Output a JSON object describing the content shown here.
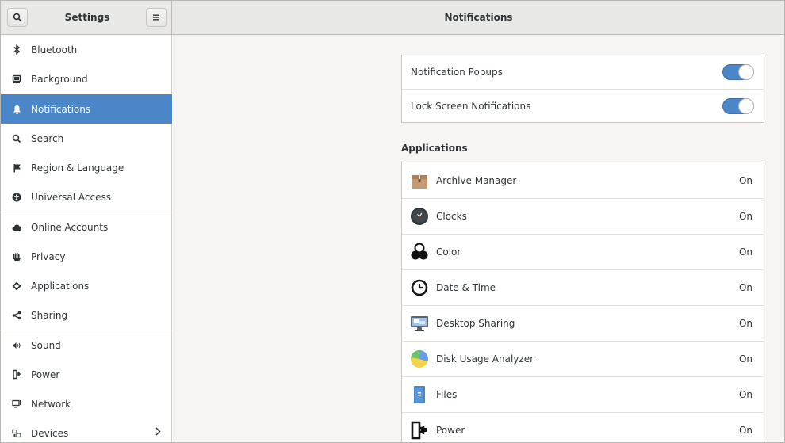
{
  "header": {
    "sidebar_title": "Settings",
    "main_title": "Notifications",
    "search_icon": "search-icon",
    "menu_icon": "hamburger-menu-icon"
  },
  "sidebar": {
    "items": [
      {
        "label": "Bluetooth",
        "icon": "bluetooth-icon"
      },
      {
        "label": "Background",
        "icon": "display-icon"
      },
      {
        "label": "Notifications",
        "icon": "bell-icon",
        "active": true
      },
      {
        "label": "Search",
        "icon": "search-icon"
      },
      {
        "label": "Region & Language",
        "icon": "flag-icon"
      },
      {
        "label": "Universal Access",
        "icon": "accessibility-icon"
      },
      {
        "label": "Online Accounts",
        "icon": "cloud-icon"
      },
      {
        "label": "Privacy",
        "icon": "hand-icon"
      },
      {
        "label": "Applications",
        "icon": "applications-icon"
      },
      {
        "label": "Sharing",
        "icon": "share-icon"
      },
      {
        "label": "Sound",
        "icon": "speaker-icon"
      },
      {
        "label": "Power",
        "icon": "power-plug-icon"
      },
      {
        "label": "Network",
        "icon": "network-icon"
      },
      {
        "label": "Devices",
        "icon": "devices-icon",
        "chevron": "chevron-right-icon"
      }
    ]
  },
  "notifications": {
    "popups_label": "Notification Popups",
    "popups_on": true,
    "lock_label": "Lock Screen Notifications",
    "lock_on": true
  },
  "applications": {
    "title": "Applications",
    "items": [
      {
        "name": "Archive Manager",
        "state": "On",
        "icon": "archive-manager-icon"
      },
      {
        "name": "Clocks",
        "state": "On",
        "icon": "clocks-icon"
      },
      {
        "name": "Color",
        "state": "On",
        "icon": "color-icon"
      },
      {
        "name": "Date & Time",
        "state": "On",
        "icon": "date-time-icon"
      },
      {
        "name": "Desktop Sharing",
        "state": "On",
        "icon": "desktop-sharing-icon"
      },
      {
        "name": "Disk Usage Analyzer",
        "state": "On",
        "icon": "disk-usage-icon"
      },
      {
        "name": "Files",
        "state": "On",
        "icon": "files-icon"
      },
      {
        "name": "Power",
        "state": "On",
        "icon": "power-icon"
      }
    ]
  },
  "colors": {
    "accent": "#4a86c8",
    "sidebar_bg": "#ffffff",
    "main_bg": "#f6f5f4",
    "header_bg": "#e8e8e7"
  }
}
